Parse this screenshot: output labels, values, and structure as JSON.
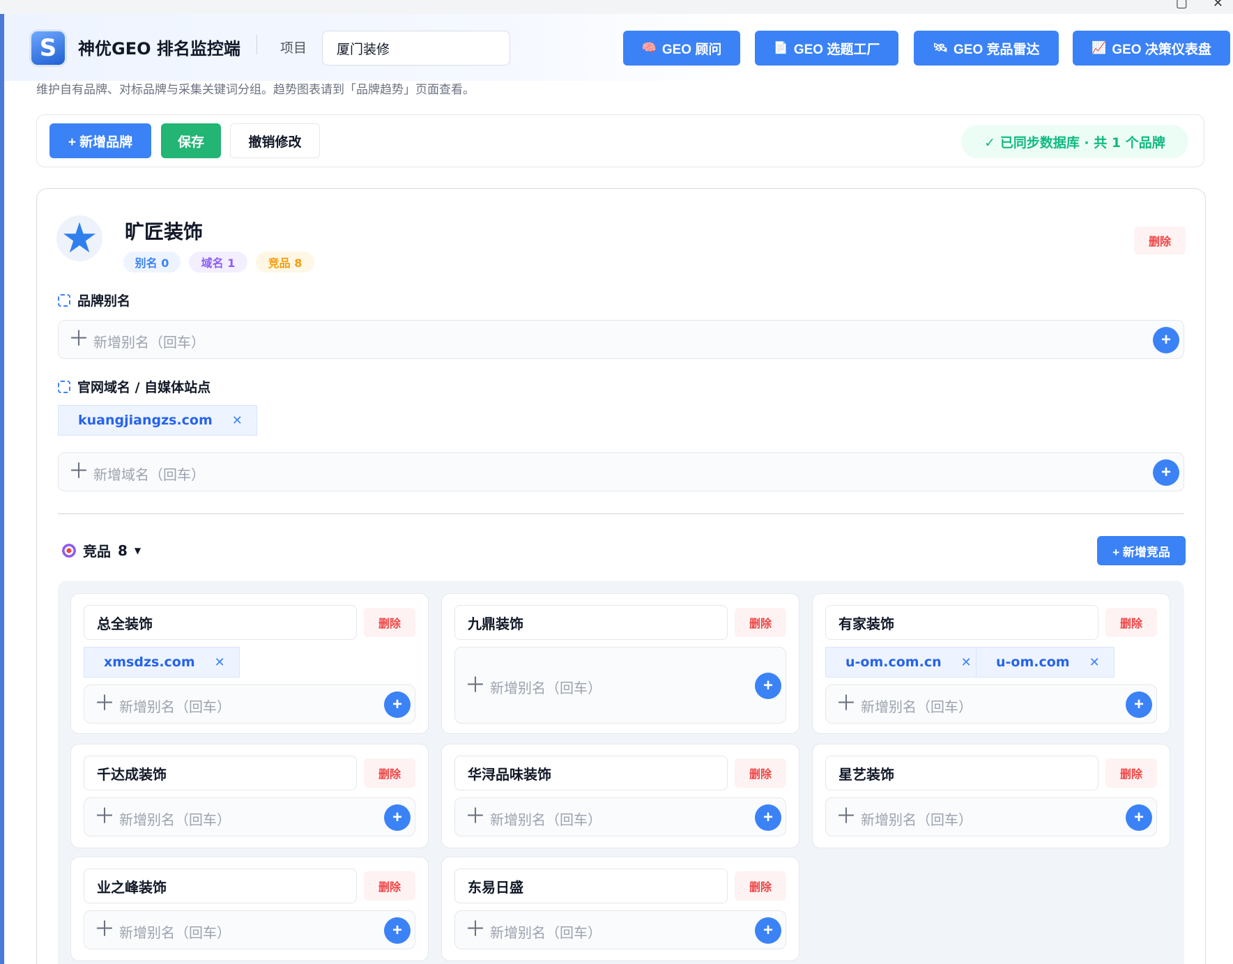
{
  "window": {
    "minimize": "▢",
    "close": "✕"
  },
  "header": {
    "logo_letter": "S",
    "title": "神优GEO 排名监控端",
    "project_label": "项目",
    "project_value": "厦门装修",
    "nav": [
      {
        "icon": "🧠",
        "label": "GEO 顾问"
      },
      {
        "icon": "📄",
        "label": "GEO 选题工厂"
      },
      {
        "icon": "🛰",
        "label": "GEO 竞品雷达"
      },
      {
        "icon": "📈",
        "label": "GEO 决策仪表盘"
      }
    ]
  },
  "subtitle": "维护自有品牌、对标品牌与采集关键词分组。趋势图表请到「品牌趋势」页面查看。",
  "toolbar": {
    "add_label": "+ 新增品牌",
    "save_label": "保存",
    "undo_label": "撤销修改",
    "sync_status": "✓ 已同步数据库 · 共 1 个品牌"
  },
  "brand": {
    "name": "旷匠装饰",
    "pills": {
      "alias": "别名 0",
      "domain": "域名 1",
      "competitor": "竞品 8"
    },
    "delete_label": "删除",
    "alias_section": "品牌别名",
    "alias_placeholder": "新增别名（回车）",
    "domain_section": "官网域名 / 自媒体站点",
    "domains": [
      "kuangjiangzs.com"
    ],
    "domain_placeholder": "新增域名（回车）",
    "competitors_title": "竞品",
    "competitors_count": "8",
    "add_competitor_label": "+ 新增竞品",
    "competitors": [
      {
        "name": "总全装饰",
        "tags": [
          "xmsdzs.com"
        ],
        "placeholder": "新增别名（回车）",
        "delete_label": "删除"
      },
      {
        "name": "九鼎装饰",
        "tags": [],
        "placeholder": "新增别名（回车）",
        "delete_label": "删除"
      },
      {
        "name": "有家装饰",
        "tags": [
          "u-om.com.cn",
          "u-om.com"
        ],
        "placeholder": "新增别名（回车）",
        "delete_label": "删除"
      },
      {
        "name": "千达成装饰",
        "tags": [],
        "placeholder": "新增别名（回车）",
        "delete_label": "删除"
      },
      {
        "name": "华浔品味装饰",
        "tags": [],
        "placeholder": "新增别名（回车）",
        "delete_label": "删除"
      },
      {
        "name": "星艺装饰",
        "tags": [],
        "placeholder": "新增别名（回车）",
        "delete_label": "删除"
      },
      {
        "name": "业之峰装饰",
        "tags": [],
        "placeholder": "新增别名（回车）",
        "delete_label": "删除"
      },
      {
        "name": "东易日盛",
        "tags": [],
        "placeholder": "新增别名（回车）",
        "delete_label": "删除"
      }
    ]
  }
}
